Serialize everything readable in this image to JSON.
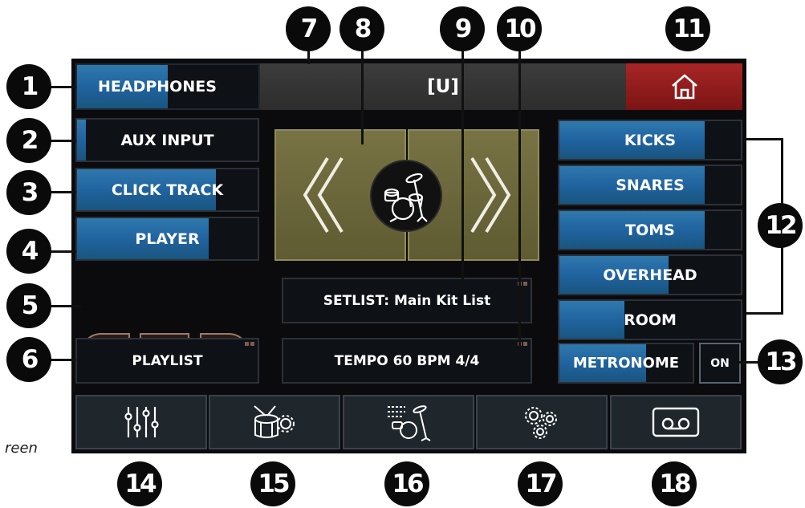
{
  "callouts": [
    "1",
    "2",
    "3",
    "4",
    "5",
    "6",
    "7",
    "8",
    "9",
    "10",
    "11",
    "12",
    "13",
    "14",
    "15",
    "16",
    "17",
    "18"
  ],
  "left": {
    "headphones": {
      "label": "HEADPHONES",
      "level": 0.5
    },
    "aux_input": {
      "label": "AUX INPUT",
      "level": 0.05
    },
    "click_track": {
      "label": "CLICK TRACK",
      "level": 0.77
    },
    "player": {
      "label": "PLAYER",
      "level": 0.73
    },
    "playlist": {
      "label": "PLAYLIST"
    }
  },
  "header": {
    "kit_name": "[U]"
  },
  "center": {
    "setlist": "SETLIST: Main Kit List",
    "tempo": "TEMPO 60 BPM 4/4"
  },
  "right": {
    "channels": [
      {
        "label": "KICKS",
        "level": 0.8
      },
      {
        "label": "SNARES",
        "level": 0.8
      },
      {
        "label": "TOMS",
        "level": 0.8
      },
      {
        "label": "OVERHEAD",
        "level": 0.6
      },
      {
        "label": "ROOM",
        "level": 0.36
      }
    ],
    "metronome": {
      "label": "METRONOME",
      "level": 0.65
    },
    "metronome_toggle": "ON"
  },
  "side_caption": "reen",
  "colors": {
    "accent_blue": "#2063a0",
    "home_red": "#8a1a1a",
    "kit_olive": "#6e6a3c"
  },
  "nav_icons": [
    "mixer-sliders-icon",
    "drum-settings-icon",
    "kit-setlist-icon",
    "system-settings-gears-icon",
    "recorder-cassette-icon"
  ]
}
